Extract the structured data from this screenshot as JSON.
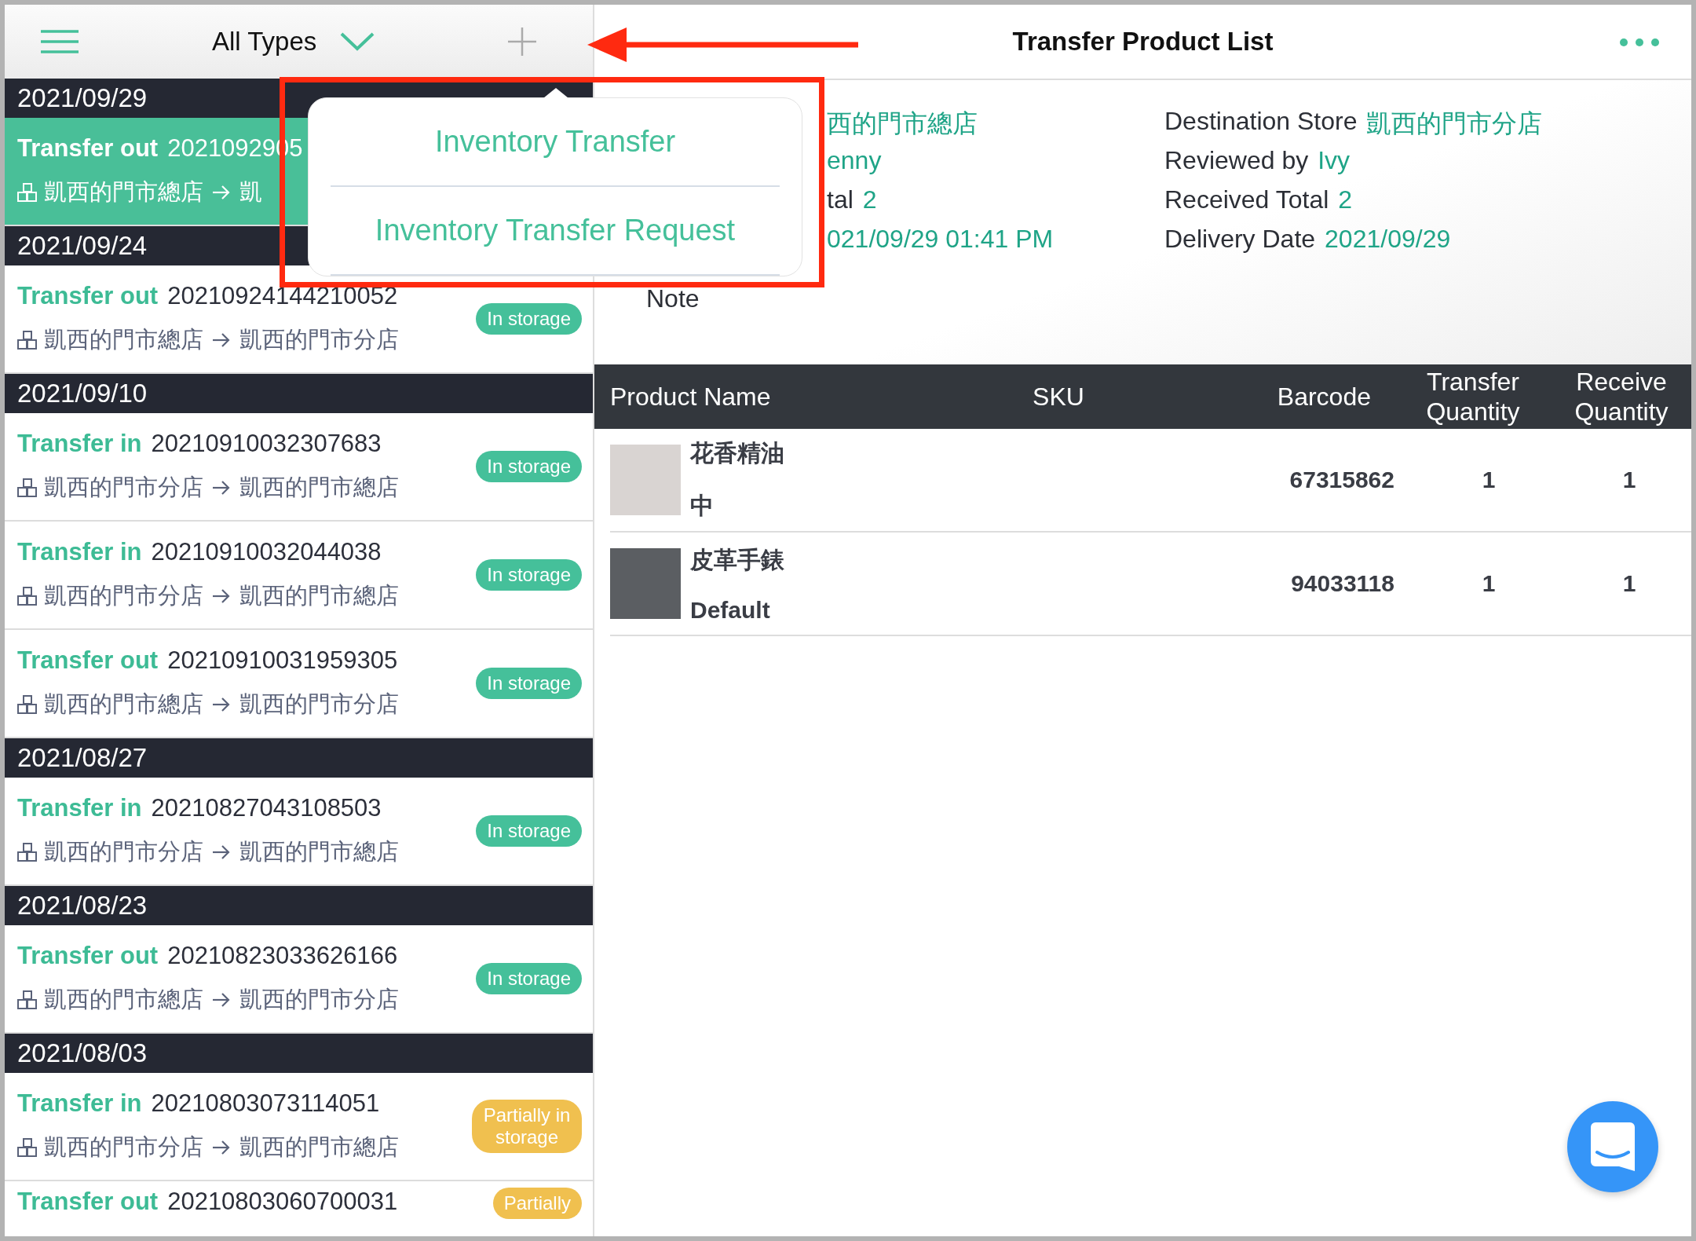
{
  "header": {
    "type_filter": "All Types",
    "title": "Transfer Product List"
  },
  "add_menu": {
    "items": [
      "Inventory Transfer",
      "Inventory Transfer Request"
    ]
  },
  "list": [
    {
      "date": "2021/09/29",
      "items": [
        {
          "type": "Transfer out",
          "number": "2021092905",
          "from": "凱西的門市總店",
          "to": "凱",
          "selected": true
        }
      ]
    },
    {
      "date": "2021/09/24",
      "items": [
        {
          "type": "Transfer out",
          "number": "20210924144210052",
          "from": "凱西的門市總店",
          "to": "凱西的門市分店",
          "status": "In storage",
          "color": "#45c09a",
          "selected": false
        }
      ]
    },
    {
      "date": "2021/09/10",
      "items": [
        {
          "type": "Transfer in",
          "number": "20210910032307683",
          "from": "凱西的門市分店",
          "to": "凱西的門市總店",
          "status": "In storage",
          "color": "#45c09a",
          "selected": false
        },
        {
          "type": "Transfer in",
          "number": "20210910032044038",
          "from": "凱西的門市分店",
          "to": "凱西的門市總店",
          "status": "In storage",
          "color": "#45c09a",
          "selected": false
        },
        {
          "type": "Transfer out",
          "number": "20210910031959305",
          "from": "凱西的門市總店",
          "to": "凱西的門市分店",
          "status": "In storage",
          "color": "#45c09a",
          "selected": false
        }
      ]
    },
    {
      "date": "2021/08/27",
      "items": [
        {
          "type": "Transfer in",
          "number": "20210827043108503",
          "from": "凱西的門市分店",
          "to": "凱西的門市總店",
          "status": "In storage",
          "color": "#45c09a",
          "selected": false
        }
      ]
    },
    {
      "date": "2021/08/23",
      "items": [
        {
          "type": "Transfer out",
          "number": "20210823033626166",
          "from": "凱西的門市總店",
          "to": "凱西的門市分店",
          "status": "In storage",
          "color": "#45c09a",
          "selected": false
        }
      ]
    },
    {
      "date": "2021/08/03",
      "items": [
        {
          "type": "Transfer in",
          "number": "20210803073114051",
          "from": "凱西的門市分店",
          "to": "凱西的門市總店",
          "status": "Partially in storage",
          "color": "#f0c04f",
          "selected": false
        },
        {
          "type": "Transfer out",
          "number": "20210803060700031",
          "status": "Partially",
          "color": "#f0c04f",
          "selected": false
        }
      ]
    }
  ],
  "detail": {
    "left": [
      {
        "value": "西的門市總店"
      },
      {
        "value": "enny"
      },
      {
        "label": "tal",
        "value": "2"
      },
      {
        "value": "021/09/29 01:41 PM"
      }
    ],
    "note_label": "Note",
    "right": [
      {
        "label": "Destination Store",
        "value": "凱西的門市分店"
      },
      {
        "label": "Reviewed by",
        "value": "Ivy"
      },
      {
        "label": "Received Total",
        "value": "2"
      },
      {
        "label": "Delivery Date",
        "value": "2021/09/29"
      }
    ]
  },
  "table": {
    "columns": [
      "Product Name",
      "SKU",
      "Barcode",
      "Transfer Quantity",
      "Receive Quantity"
    ],
    "rows": [
      {
        "name": "花香精油",
        "variant": "中",
        "barcode": "67315862",
        "transfer_quantity": "1",
        "receive_quantity": "1"
      },
      {
        "name": "皮革手錶",
        "variant": "Default",
        "barcode": "94033118",
        "transfer_quantity": "1",
        "receive_quantity": "1"
      }
    ]
  }
}
